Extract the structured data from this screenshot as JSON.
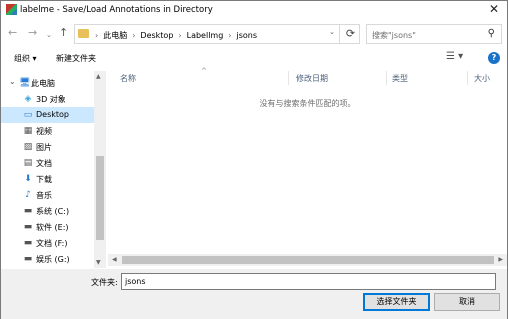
{
  "window": {
    "title": "labelme - Save/Load Annotations in Directory",
    "close_glyph": "✕"
  },
  "nav": {
    "back_glyph": "←",
    "forward_glyph": "→",
    "recent_glyph": "⌄",
    "up_glyph": "↑",
    "breadcrumbs": [
      "此电脑",
      "Desktop",
      "Labellmg",
      "jsons"
    ],
    "separator": "›",
    "address_dropdown_glyph": "⌄",
    "refresh_glyph": "⟳"
  },
  "search": {
    "placeholder": "搜索\"jsons\"",
    "icon": "search-icon",
    "glyph": "⚲"
  },
  "toolbar": {
    "organize_label": "组织 ▾",
    "new_folder_label": "新建文件夹",
    "view_glyph": "☰ ▾",
    "help_glyph": "?"
  },
  "tree": {
    "items": [
      {
        "label": "此电脑",
        "icon": "computer-icon",
        "glyph": "🖥"
      },
      {
        "label": "3D 对象",
        "icon": "cube-icon",
        "glyph": "◈"
      },
      {
        "label": "Desktop",
        "icon": "desktop-icon",
        "glyph": "▭",
        "selected": true
      },
      {
        "label": "视频",
        "icon": "video-icon",
        "glyph": "▦"
      },
      {
        "label": "图片",
        "icon": "image-icon",
        "glyph": "▨"
      },
      {
        "label": "文档",
        "icon": "document-icon",
        "glyph": "▤"
      },
      {
        "label": "下载",
        "icon": "download-icon",
        "glyph": "⬇"
      },
      {
        "label": "音乐",
        "icon": "music-icon",
        "glyph": "♪"
      },
      {
        "label": "系统 (C:)",
        "icon": "drive-icon",
        "glyph": "▬"
      },
      {
        "label": "软件 (E:)",
        "icon": "drive-icon",
        "glyph": "▬"
      },
      {
        "label": "文档 (F:)",
        "icon": "drive-icon",
        "glyph": "▬"
      },
      {
        "label": "娱乐 (G:)",
        "icon": "drive-icon",
        "glyph": "▬"
      }
    ]
  },
  "list": {
    "columns": [
      "名称",
      "修改日期",
      "类型",
      "大小"
    ],
    "sort_glyph": "^",
    "empty_message": "没有与搜索条件匹配的项。"
  },
  "scroll": {
    "up": "▲",
    "down": "▼",
    "left": "◀",
    "right": "▶"
  },
  "footer": {
    "filename_label": "文件夹:",
    "filename_value": "jsons",
    "ok_label": "选择文件夹",
    "cancel_label": "取消"
  },
  "colors": {
    "accent": "#0078d7",
    "selection": "#cce8ff"
  }
}
